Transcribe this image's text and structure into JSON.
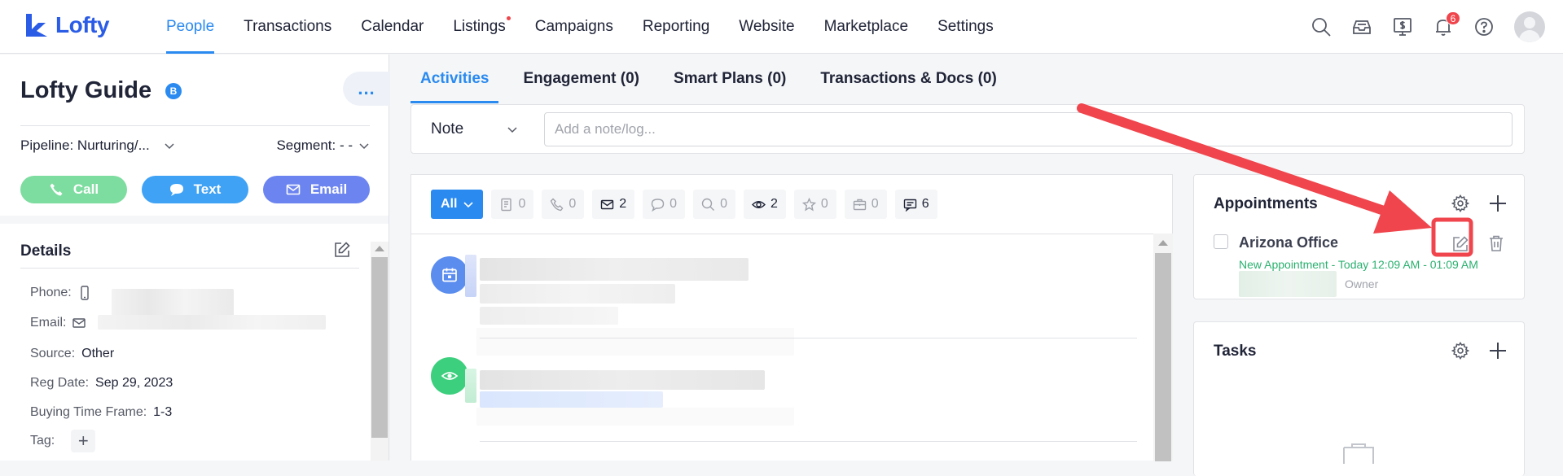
{
  "app": {
    "brand": "Lofty",
    "accent": "#2a8af0",
    "brand_color": "#2b5ce6"
  },
  "nav": {
    "items": [
      {
        "label": "People",
        "active": true
      },
      {
        "label": "Transactions"
      },
      {
        "label": "Calendar"
      },
      {
        "label": "Listings",
        "dot": true
      },
      {
        "label": "Campaigns"
      },
      {
        "label": "Reporting"
      },
      {
        "label": "Website"
      },
      {
        "label": "Marketplace"
      },
      {
        "label": "Settings"
      }
    ],
    "icons": [
      "search-icon",
      "inbox-icon",
      "billing-icon",
      "bell-icon",
      "help-icon",
      "avatar"
    ],
    "notification_count": "6"
  },
  "contact": {
    "name": "Lofty Guide",
    "badge": "B",
    "more": "...",
    "pipeline": "Pipeline: Nurturing/...",
    "segment": "Segment: - -",
    "actions": {
      "call": "Call",
      "text": "Text",
      "email": "Email"
    }
  },
  "details": {
    "title": "Details",
    "phone_label": "Phone:",
    "email_label": "Email:",
    "source_label": "Source:",
    "source_value": "Other",
    "reg_label": "Reg Date:",
    "reg_value": "Sep 29, 2023",
    "timeframe_label": "Buying Time Frame:",
    "timeframe_value": "1-3",
    "tag_label": "Tag:",
    "tag_add": "+"
  },
  "tabs": [
    {
      "label": "Activities",
      "active": true
    },
    {
      "label": "Engagement (0)"
    },
    {
      "label": "Smart Plans (0)"
    },
    {
      "label": "Transactions & Docs (0)"
    }
  ],
  "note": {
    "type": "Note",
    "placeholder": "Add a note/log..."
  },
  "filters": {
    "all": "All",
    "chips": [
      {
        "icon": "note-icon",
        "count": "0"
      },
      {
        "icon": "phone-icon",
        "count": "0"
      },
      {
        "icon": "email-icon",
        "count": "2"
      },
      {
        "icon": "chat-icon",
        "count": "0"
      },
      {
        "icon": "search-icon",
        "count": "0"
      },
      {
        "icon": "eye-icon",
        "count": "2"
      },
      {
        "icon": "star-icon",
        "count": "0"
      },
      {
        "icon": "briefcase-icon",
        "count": "0"
      },
      {
        "icon": "message-icon",
        "count": "6"
      }
    ]
  },
  "timeline": {
    "icons": [
      {
        "icon": "calendar-icon",
        "color": "#5b8def"
      },
      {
        "icon": "eye-icon",
        "color": "#3ccf7d"
      }
    ]
  },
  "appointments": {
    "title": "Appointments",
    "item": {
      "name": "Arizona Office",
      "subtitle": "New Appointment - Today 12:09 AM - 01:09 AM",
      "owner": "Owner"
    }
  },
  "tasks": {
    "title": "Tasks"
  },
  "annotation": {
    "color": "#f0454c"
  }
}
